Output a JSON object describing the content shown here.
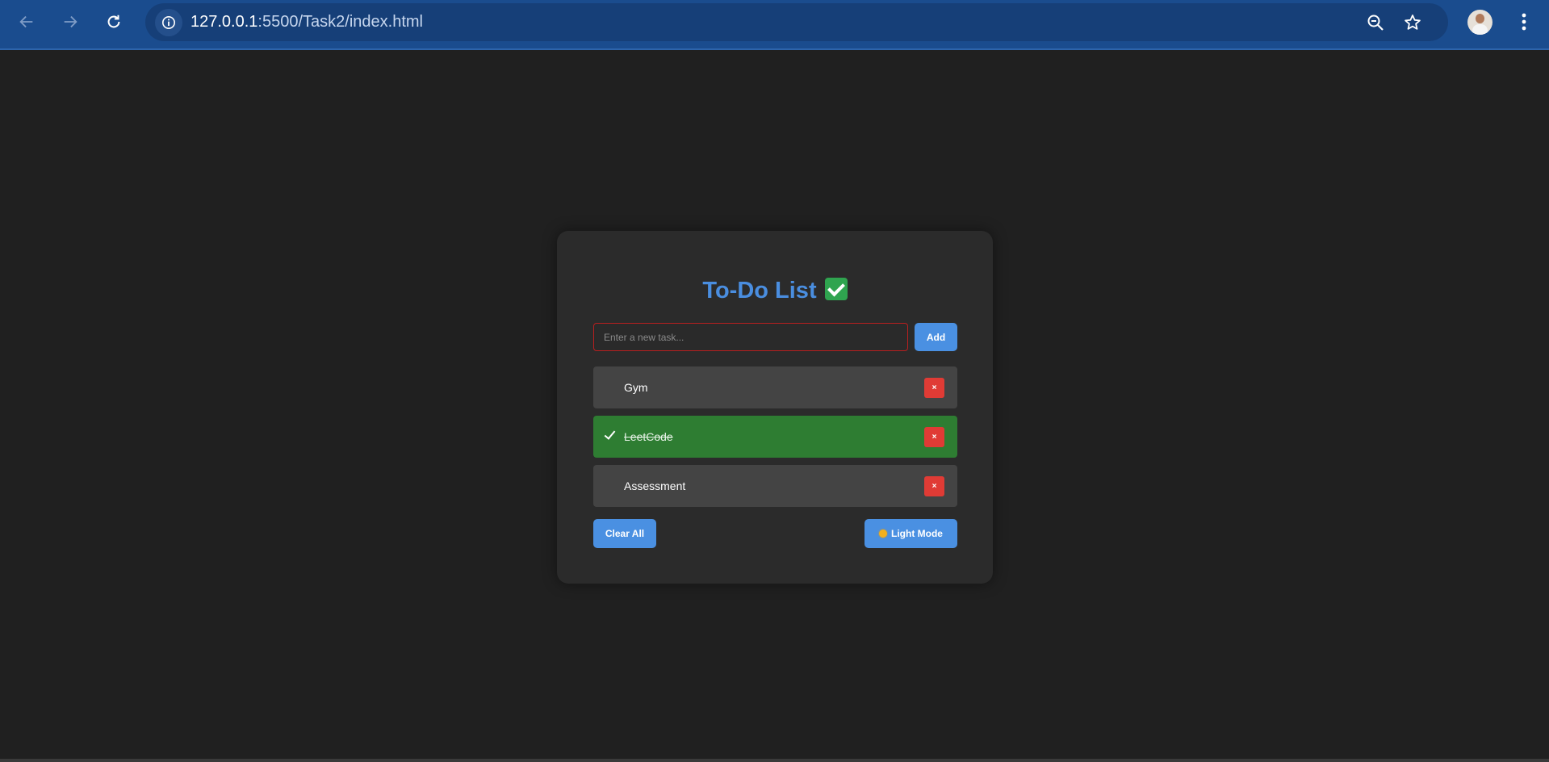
{
  "browser": {
    "url_host": "127.0.0.1",
    "url_path": ":5500/Task2/index.html",
    "icons": {
      "back": "arrow-left-icon",
      "forward": "arrow-right-icon",
      "reload": "reload-icon",
      "site_info": "info-icon",
      "zoom": "zoom-out-icon",
      "bookmark": "star-icon",
      "menu": "kebab-menu-icon"
    },
    "colors": {
      "toolbar": "#1a4c8e",
      "omnibox": "#163f78"
    }
  },
  "app": {
    "title": "To-Do List",
    "title_icon": "check-mark-button-icon",
    "input": {
      "placeholder": "Enter a new task...",
      "value": ""
    },
    "add_label": "Add",
    "delete_symbol": "×",
    "tasks": [
      {
        "label": "Gym",
        "done": false
      },
      {
        "label": "LeetCode",
        "done": true
      },
      {
        "label": "Assessment",
        "done": false
      }
    ],
    "clear_label": "Clear All",
    "mode_label": "Light Mode",
    "mode_icon": "sun-icon",
    "colors": {
      "background": "#202020",
      "card": "#2b2b2b",
      "accent": "#4a90e2",
      "title": "#4a8ee0",
      "task": "#444444",
      "task_done": "#2e7d32",
      "delete": "#e03b35",
      "input_border": "#b81f1f"
    }
  }
}
